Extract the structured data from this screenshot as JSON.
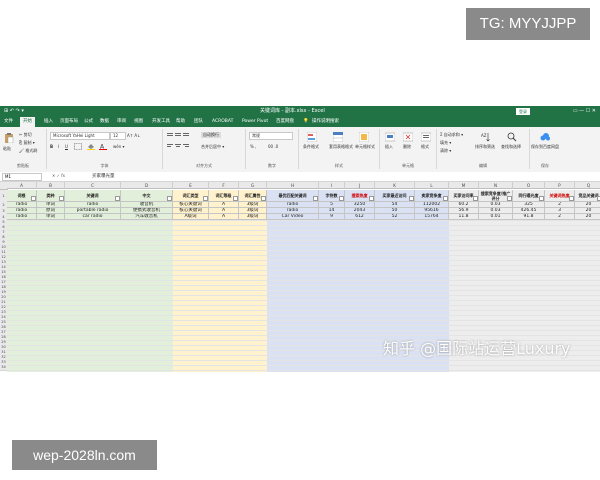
{
  "watermarks": {
    "top": "TG: MYYJJPP",
    "bottom": "wep-2028ln.com",
    "overlay": "知乎 @国际站运营Luxury"
  },
  "titlebar": {
    "title": "关键词库 - 副本.xlsx - Excel",
    "login": "登录",
    "qat": "⊞ ↶ ↷ ▾",
    "window_controls": "▭ — ☐ ✕"
  },
  "tabs": [
    "文件",
    "开始",
    "插入",
    "页面布局",
    "公式",
    "数据",
    "审阅",
    "视图",
    "开发工具",
    "帮助",
    "团队",
    "ACROBAT",
    "Power Pivot",
    "百度网盘",
    "💡",
    "操作说明搜索"
  ],
  "ribbon": {
    "clipboard": {
      "label": "剪贴板",
      "paste": "粘贴",
      "cut": "✂ 剪切",
      "copy": "⎘ 复制 ▾",
      "painter": "🖌 格式刷"
    },
    "font": {
      "label": "字体",
      "name": "Microsoft YaHei Light",
      "size": "12",
      "grow": "A↑ A↓",
      "bold": "B",
      "italic": "I",
      "underline": "U",
      "phonetic": "wén ▾"
    },
    "align": {
      "label": "对齐方式",
      "wrap": "自动换行",
      "merge": "合并后居中 ▾"
    },
    "number": {
      "label": "数字",
      "format": "常规",
      "pct": "% ,",
      "dec": "00 .0"
    },
    "styles": {
      "label": "样式",
      "cond": "条件格式",
      "table": "套用表格格式",
      "cell": "单元格样式"
    },
    "cells": {
      "label": "单元格",
      "insert": "插入",
      "delete": "删除",
      "format": "格式"
    },
    "editing": {
      "label": "编辑",
      "autosum": "Σ 自动求和 ▾",
      "fill": "填充 ▾",
      "clear": "清除 ▾",
      "sort": "排序和筛选",
      "find": "查找和选择"
    },
    "save": {
      "label": "保存",
      "baidu": "保存到百度网盘"
    }
  },
  "formula_bar": {
    "name_box": "M1",
    "fx": "✕ ✓ fx",
    "content": "买家曝光量"
  },
  "columns": [
    "A",
    "B",
    "C",
    "D",
    "E",
    "F",
    "G",
    "H",
    "I",
    "J",
    "K",
    "L",
    "M",
    "N",
    "O",
    "P",
    "Q",
    "R"
  ],
  "headers": [
    "词根",
    "类种",
    "关键词",
    "中文",
    "词汇类型",
    "词汇等级",
    "词汇属性",
    "最优匹配关键词",
    "字符数",
    "搜索热度",
    "买家最近访问",
    "卖家竞争度",
    "买家访问率",
    "搜索竞争度/推广评分",
    "同行曝光度",
    "关键词热度",
    "竞品关键词",
    "总竞价"
  ],
  "rows": [
    [
      "radio",
      "单词",
      "radio",
      "收音机",
      "核心关键词",
      "A",
      "3级词",
      "radio",
      "5",
      "3250",
      "54",
      "112002",
      "60.2",
      "0.03",
      "325",
      "2",
      "20"
    ],
    [
      "radio",
      "原词",
      "portable radio",
      "便携式收音机",
      "核心关键词",
      "A",
      "3级词",
      "radio",
      "14",
      "2043",
      "50",
      "95616",
      "56.9",
      "0.03",
      "426.45",
      "3",
      "20"
    ],
    [
      "radio",
      "单词",
      "car radio",
      "汽车收音机",
      "A级词",
      "A",
      "3级词",
      "Car Video",
      "9",
      "612",
      "52",
      "15764",
      "11.8",
      "0.01",
      "91.8",
      "2",
      "20"
    ]
  ],
  "row_numbers": [
    "1",
    "2",
    "3",
    "4",
    "5",
    "6",
    "7",
    "8",
    "9",
    "10",
    "11",
    "12",
    "13",
    "14",
    "15",
    "16",
    "17",
    "18",
    "19",
    "20",
    "21",
    "22",
    "23",
    "24",
    "25",
    "26",
    "27",
    "28",
    "29",
    "30",
    "31",
    "32",
    "33",
    "34",
    "35",
    "36"
  ],
  "colors": {
    "excel_green": "#217346",
    "band_green": "#e2efda",
    "band_yellow": "#fff2cc",
    "band_blue": "#d9e1f2",
    "band_grey": "#ededed",
    "red_header": "#d00000"
  }
}
